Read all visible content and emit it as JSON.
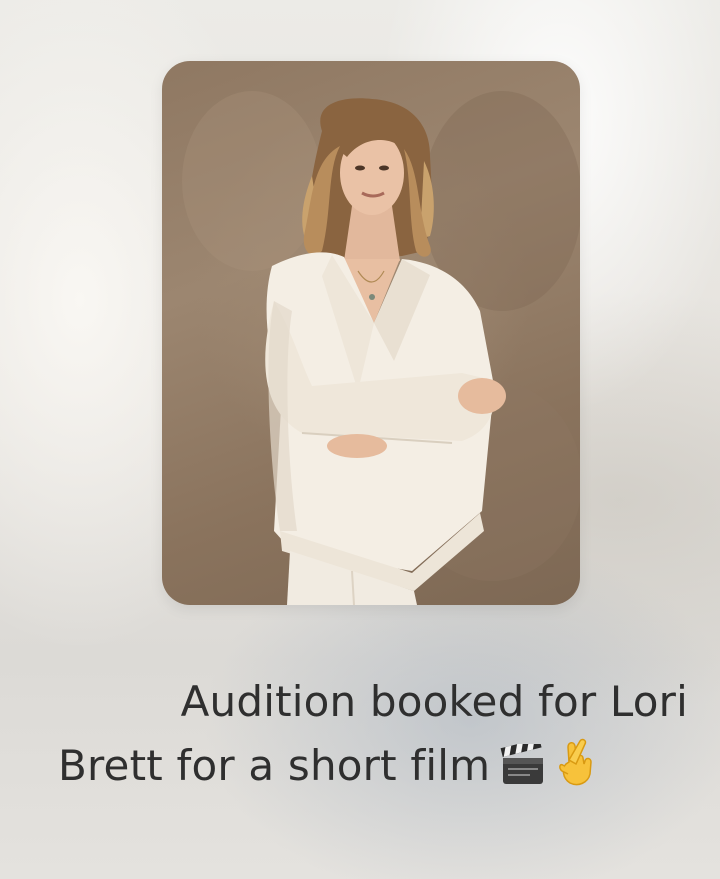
{
  "post": {
    "caption_line1": "Audition booked for Lori",
    "caption_line2": "Brett for a short film"
  },
  "icons": [
    "clapperboard-icon",
    "crossed-fingers-icon"
  ],
  "colors": {
    "caption_text": "#2f2f2f",
    "photo_backdrop": "#937c66",
    "suit": "#f3ede3"
  }
}
